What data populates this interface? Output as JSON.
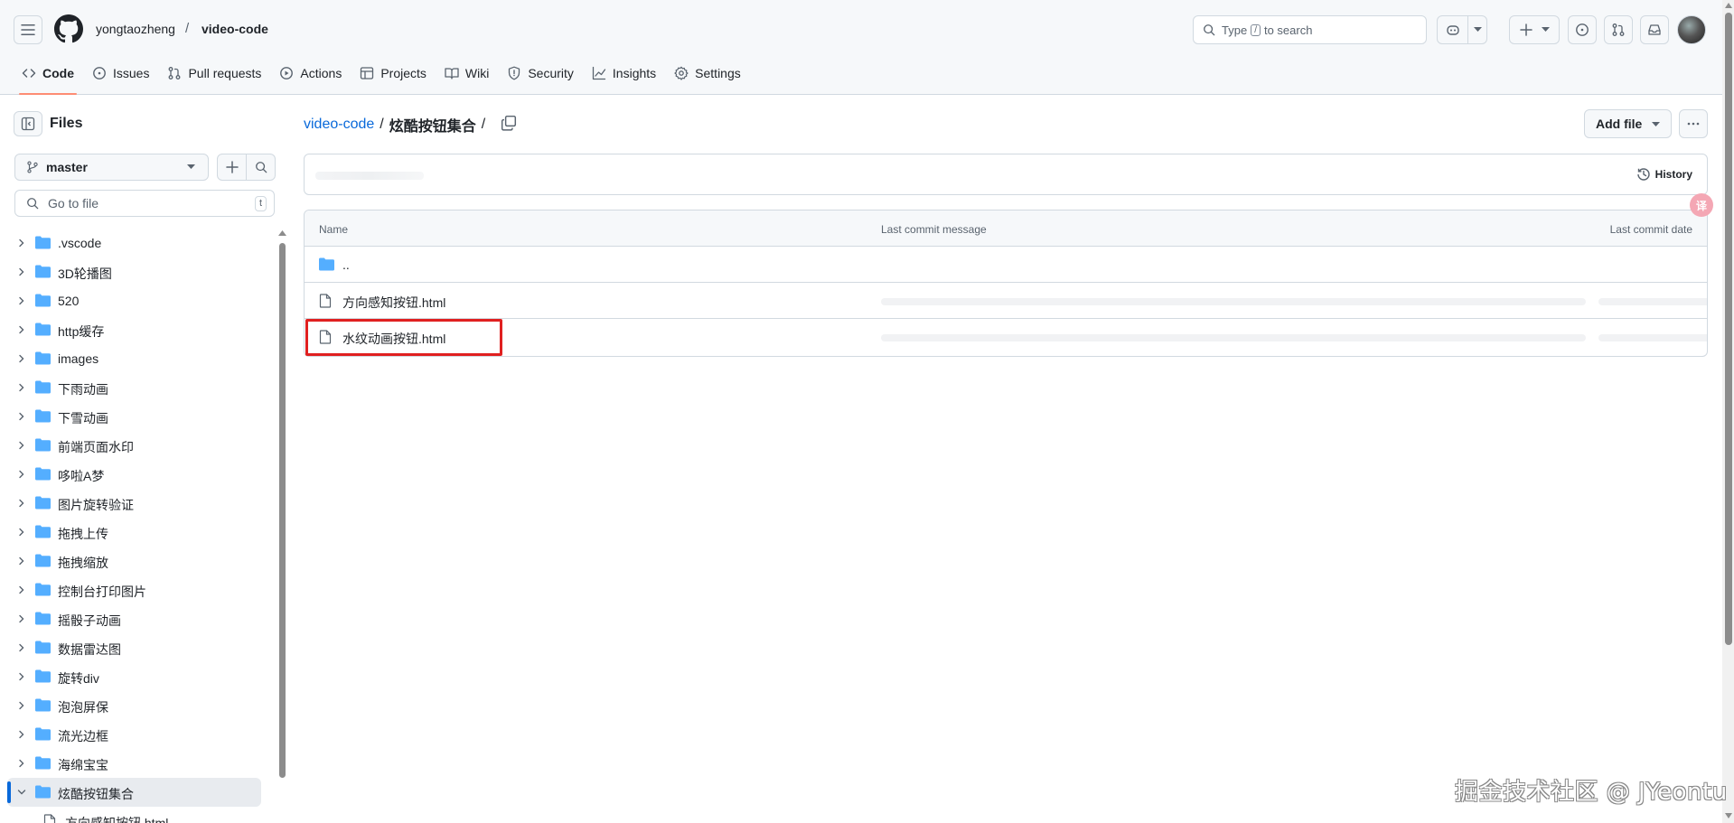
{
  "header": {
    "owner": "yongtaozheng",
    "separator": "/",
    "repo": "video-code",
    "search": {
      "prefix": "Type",
      "key": "/",
      "suffix": "to search"
    }
  },
  "nav": [
    {
      "label": "Code",
      "icon": "code-icon",
      "active": true
    },
    {
      "label": "Issues",
      "icon": "issue-opened-icon"
    },
    {
      "label": "Pull requests",
      "icon": "git-pull-request-icon"
    },
    {
      "label": "Actions",
      "icon": "play-icon"
    },
    {
      "label": "Projects",
      "icon": "table-icon"
    },
    {
      "label": "Wiki",
      "icon": "book-icon"
    },
    {
      "label": "Security",
      "icon": "shield-icon"
    },
    {
      "label": "Insights",
      "icon": "graph-icon"
    },
    {
      "label": "Settings",
      "icon": "gear-icon"
    }
  ],
  "sidebar": {
    "title": "Files",
    "branch": "master",
    "goto_placeholder": "Go to file",
    "goto_shortcut": "t",
    "tree": [
      ".vscode",
      "3D轮播图",
      "520",
      "http缓存",
      "images",
      "下雨动画",
      "下雪动画",
      "前端页面水印",
      "哆啦A梦",
      "图片旋转验证",
      "拖拽上传",
      "拖拽缩放",
      "控制台打印图片",
      "摇骰子动画",
      "数据雷达图",
      "旋转div",
      "泡泡屏保",
      "流光边框",
      "海绵宝宝"
    ],
    "selected_folder": "炫酷按钮集合",
    "selected_child": "方向感知按钮.html"
  },
  "main": {
    "breadcrumb_repo": "video-code",
    "breadcrumb_sep": "/",
    "breadcrumb_folder": "炫酷按钮集合",
    "breadcrumb_trailing": "/",
    "add_file": "Add file",
    "history": "History",
    "table": {
      "col_name": "Name",
      "col_message": "Last commit message",
      "col_date": "Last commit date",
      "parent": "..",
      "files": [
        "方向感知按钮.html",
        "水纹动画按钮.html"
      ]
    }
  },
  "translate_badge": "译",
  "watermark": "掘金技术社区 @ JYeontu",
  "colors": {
    "accent": "#0969da",
    "nav_underline": "#fd8c73",
    "folder": "#54aeff",
    "highlight": "#e02020"
  }
}
